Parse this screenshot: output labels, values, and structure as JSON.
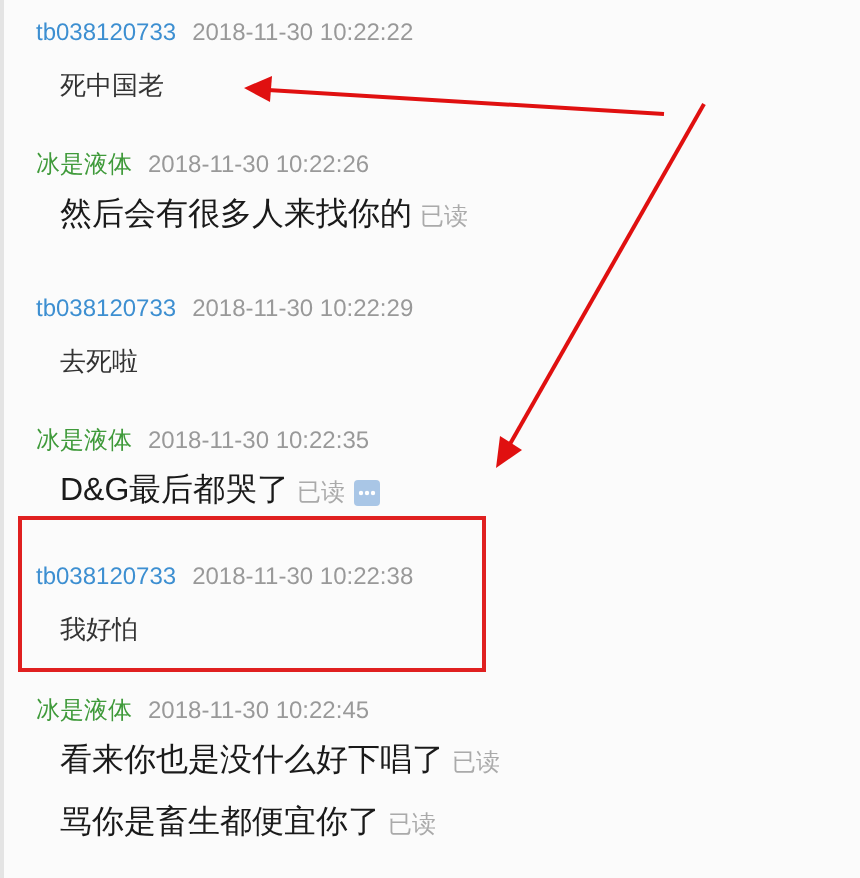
{
  "messages": [
    {
      "sender": "tb038120733",
      "kind": "buyer",
      "time": "2018-11-30 10:22:22",
      "highlighted": false,
      "lines": [
        {
          "text": "死中国老",
          "options_icon": false
        }
      ]
    },
    {
      "sender": "冰是液体",
      "kind": "seller",
      "time": "2018-11-30 10:22:26",
      "highlighted": false,
      "lines": [
        {
          "text": "然后会有很多人来找你的",
          "status": "已读",
          "options_icon": false
        }
      ]
    },
    {
      "sender": "tb038120733",
      "kind": "buyer",
      "time": "2018-11-30 10:22:29",
      "highlighted": false,
      "lines": [
        {
          "text": "去死啦",
          "options_icon": false
        }
      ]
    },
    {
      "sender": "冰是液体",
      "kind": "seller",
      "time": "2018-11-30 10:22:35",
      "highlighted": false,
      "lines": [
        {
          "text": "D&G最后都哭了",
          "status": "已读",
          "options_icon": true
        }
      ]
    },
    {
      "sender": "tb038120733",
      "kind": "buyer",
      "time": "2018-11-30 10:22:38",
      "highlighted": true,
      "lines": [
        {
          "text": "我好怕",
          "options_icon": false
        }
      ]
    },
    {
      "sender": "冰是液体",
      "kind": "seller",
      "time": "2018-11-30 10:22:45",
      "highlighted": false,
      "lines": [
        {
          "text": "看来你也是没什么好下唱了",
          "status": "已读",
          "options_icon": false
        },
        {
          "text": "骂你是畜生都便宜你了",
          "status": "已读",
          "options_icon": false
        }
      ]
    }
  ]
}
